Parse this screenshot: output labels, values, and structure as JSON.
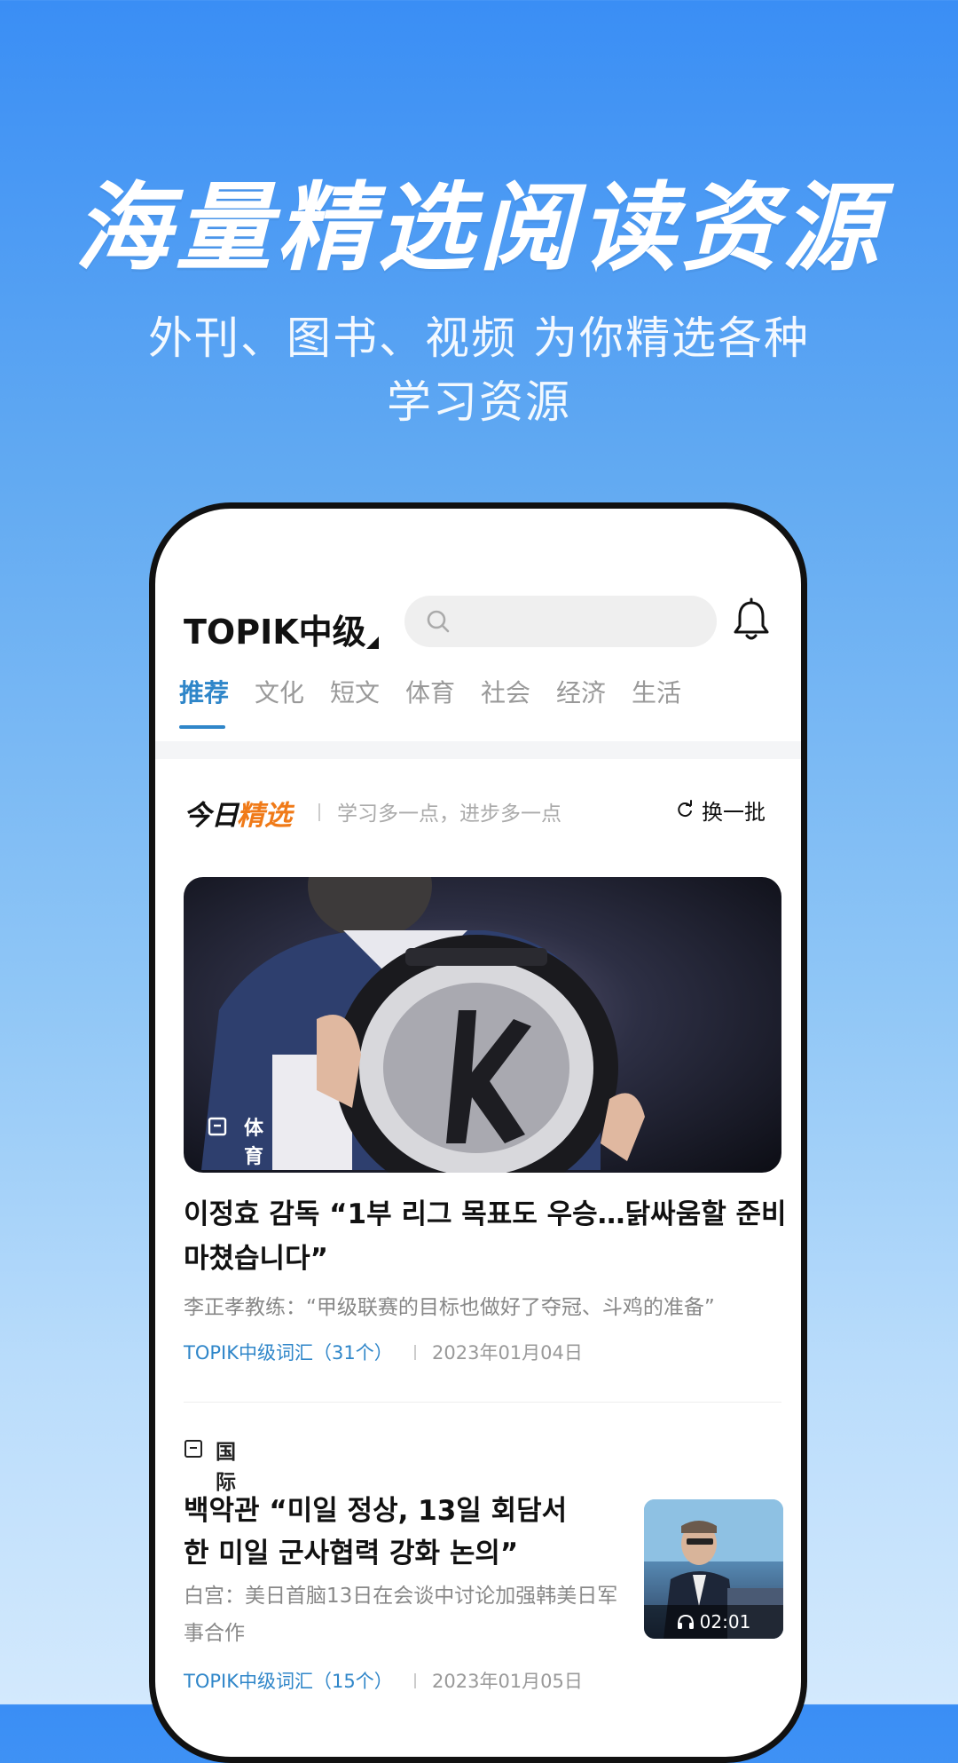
{
  "promo": {
    "headline": "海量精选阅读资源",
    "subline_1": "外刊、图书、视频 为你精选各种",
    "subline_2": "学习资源"
  },
  "app": {
    "title": "TOPIK中级",
    "search_placeholder": ""
  },
  "tabs": [
    "推荐",
    "文化",
    "短文",
    "体育",
    "社会",
    "经济",
    "生活"
  ],
  "active_tab_index": 0,
  "picks": {
    "title_a": "今日",
    "title_b": "精选",
    "slogan": "学习多一点，进步多一点",
    "refresh_label": "换一批"
  },
  "articles": [
    {
      "category": "体育",
      "title": "이정효 감독 “1부 리그 목표도 우승…닭싸움할 준비 마쳤습니다”",
      "subtitle": "李正孝教练：“甲级联赛的目标也做好了夺冠、斗鸡的准备”",
      "vocab": "TOPIK中级词汇（31个）",
      "date": "2023年01月04日"
    },
    {
      "category": "国际",
      "title": "백악관 “미일 정상, 13일 회담서 한 미일 군사협력 강화 논의”",
      "subtitle": "白宫：美日首脑13日在会谈中讨论加强韩美日军事合作",
      "duration": "02:01",
      "vocab": "TOPIK中级词汇（15个）",
      "date": "2023年01月05日"
    }
  ],
  "colors": {
    "accent": "#2f86c9",
    "picks_orange": "#f07a18",
    "background_top": "#3a8ef5",
    "background_bottom": "#d3e9fd"
  },
  "icons": {
    "search": "search-icon",
    "bell": "bell-icon",
    "refresh": "refresh-icon",
    "category": "bookmark-icon",
    "audio": "headphones-icon"
  }
}
